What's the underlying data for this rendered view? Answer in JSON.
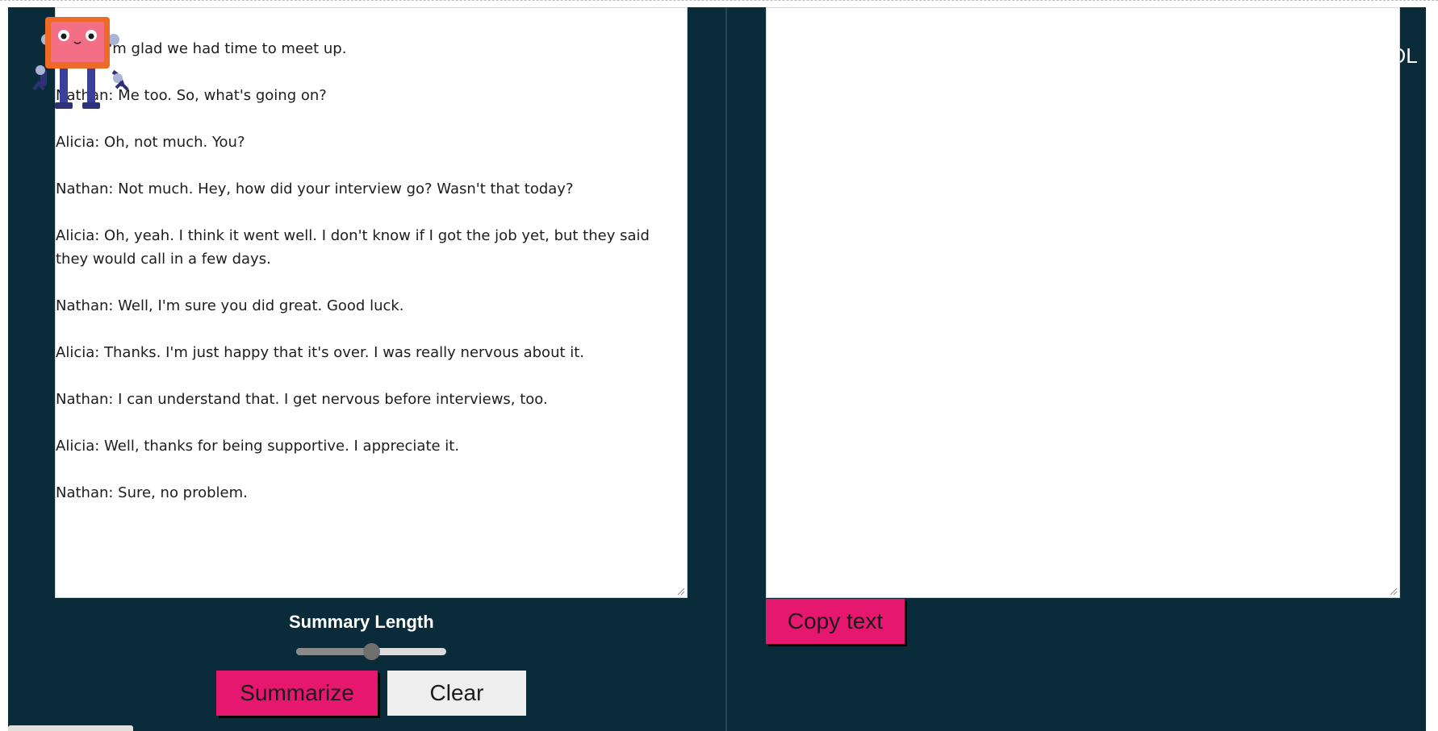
{
  "conversation": {
    "lines": [
      "Alicia: I'm glad we had time to meet up.",
      "Nathan: Me too. So, what's going on?",
      "Alicia: Oh, not much. You?",
      "Nathan: Not much. Hey, how did your interview go? Wasn't that today?",
      "Alicia: Oh, yeah. I think it went well. I don't know if I got the job yet, but they said they would call in a few days.",
      "Nathan: Well, I'm sure you did great. Good luck.",
      "Alicia: Thanks. I'm just happy that it's over. I was really nervous about it.",
      "Nathan: I can understand that. I get nervous before interviews, too.",
      "Alicia: Well, thanks for being supportive. I appreciate it.",
      "Nathan: Sure, no problem."
    ]
  },
  "logo_text": "OL",
  "controls": {
    "summary_length_label": "Summary Length",
    "summary_length_value": 0.5,
    "summarize_label": "Summarize",
    "clear_label": "Clear",
    "copy_label": "Copy text"
  },
  "colors": {
    "background": "#0a2c3a",
    "accent": "#e5176f",
    "clear_button": "#eeeeee"
  },
  "icons": [
    "robot-mascot-icon",
    "resize-handle-icon"
  ]
}
